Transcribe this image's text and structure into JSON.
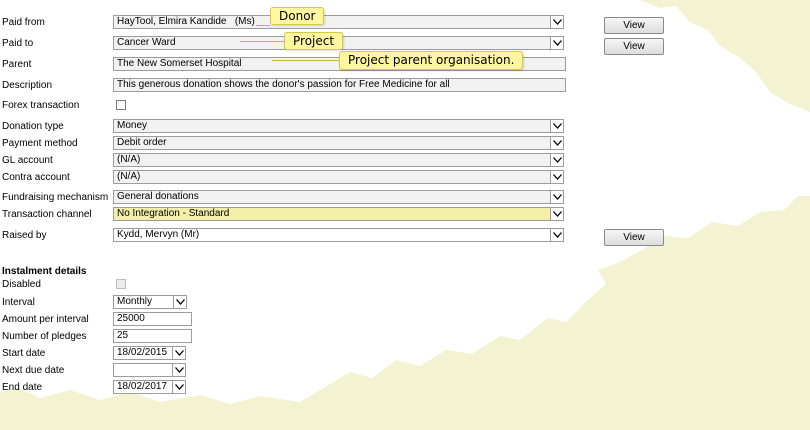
{
  "form": {
    "paid_from": {
      "label": "Paid from",
      "value": "HayTool, Elmira Kandide   (Ms)",
      "view_button": "View"
    },
    "paid_to": {
      "label": "Paid to",
      "value": "Cancer Ward",
      "view_button": "View"
    },
    "parent": {
      "label": "Parent",
      "value": "The New Somerset Hospital"
    },
    "description": {
      "label": "Description",
      "value": "This generous donation shows the donor's passion for Free Medicine for all"
    },
    "forex": {
      "label": "Forex transaction",
      "checked": false
    },
    "donation_type": {
      "label": "Donation type",
      "value": "Money"
    },
    "payment_method": {
      "label": "Payment method",
      "value": "Debit order"
    },
    "gl_account": {
      "label": "GL account",
      "value": "(N/A)"
    },
    "contra_account": {
      "label": "Contra account",
      "value": "(N/A)"
    },
    "fundraising_mechanism": {
      "label": "Fundraising mechanism",
      "value": "General donations"
    },
    "transaction_channel": {
      "label": "Transaction channel",
      "value": "No Integration - Standard"
    },
    "raised_by": {
      "label": "Raised by",
      "value": "Kydd, Mervyn (Mr)",
      "view_button": "View"
    }
  },
  "instalment": {
    "heading": "Instalment details",
    "disabled": {
      "label": "Disabled",
      "checked": false
    },
    "interval": {
      "label": "Interval",
      "value": "Monthly"
    },
    "amount_per_interval": {
      "label": "Amount per interval",
      "value": "25000"
    },
    "number_of_pledges": {
      "label": "Number of pledges",
      "value": "25"
    },
    "start_date": {
      "label": "Start date",
      "value": "18/02/2015"
    },
    "next_due_date": {
      "label": "Next due date",
      "value": ""
    },
    "end_date": {
      "label": "End date",
      "value": "18/02/2017"
    }
  },
  "callouts": {
    "donor": "Donor",
    "project": "Project",
    "project_parent": "Project parent organisation."
  },
  "colors": {
    "highlight_field": "#f3eea8",
    "callout_fill": "#fff6a0",
    "torn_paper": "#f3f3d2"
  },
  "icons": {
    "dropdown": "chevron-down-icon"
  }
}
